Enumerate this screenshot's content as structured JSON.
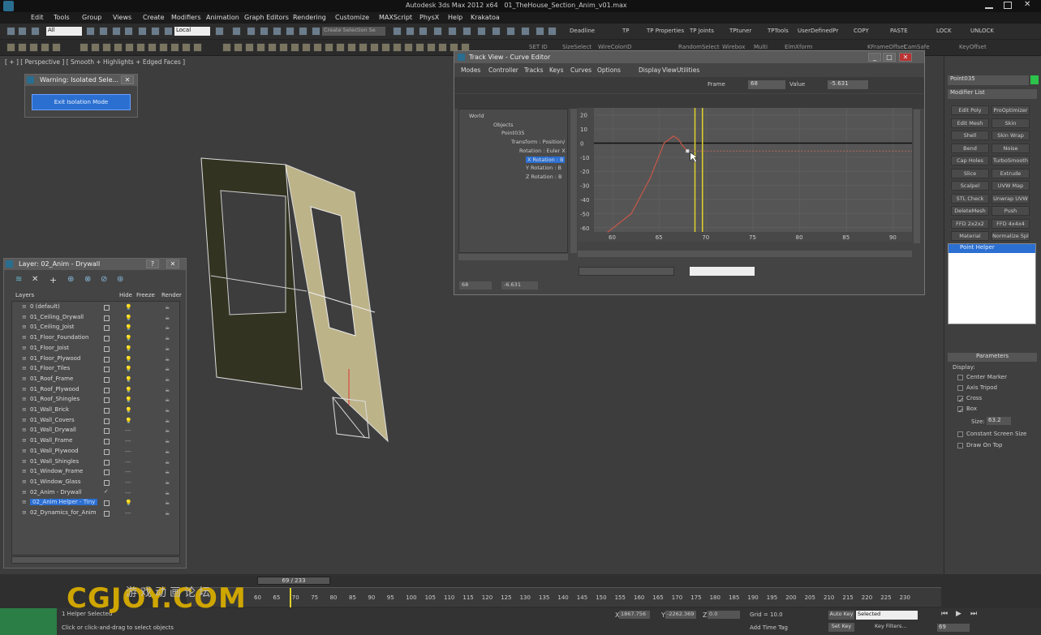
{
  "app": {
    "title": "Autodesk 3ds Max  2012 x64",
    "file": "01_TheHouse_Section_Anim_v01.max"
  },
  "menus": [
    "Edit",
    "Tools",
    "Group",
    "Views",
    "Create",
    "Modifiers",
    "Animation",
    "Graph Editors",
    "Rendering",
    "Customize",
    "MAXScript",
    "PhysX",
    "Help",
    "Krakatoa"
  ],
  "toolbar": {
    "filter": "All",
    "coord": "Local",
    "selset": "Create Selection Se",
    "labels": [
      "Deadline",
      "TP",
      "TP Properties",
      "TP Joints",
      "TPtuner",
      "TPTools",
      "UserDefinedPr",
      "COPY",
      "PASTE",
      "LOCK",
      "UNLOCK"
    ]
  },
  "toolbar2": {
    "labels": [
      "SET ID",
      "SizeSelect",
      "WireColorID",
      "RandomSelect",
      "Wirebox",
      "Multi",
      "ElmXform",
      "KFrameOffset",
      "CamSafe",
      "KeyOffset",
      "BG"
    ]
  },
  "viewport": {
    "label": "[ + ] [ Perspective ] [ Smooth + Highlights + Edged Faces ]"
  },
  "isolation": {
    "title": "Warning: Isolated Sele...",
    "button": "Exit Isolation Mode"
  },
  "layers": {
    "title": "Layer: 02_Anim - Drywall",
    "cols": {
      "name": "Layers",
      "hide": "Hide",
      "freeze": "Freeze",
      "render": "Render"
    },
    "items": [
      "0 (default)",
      "01_Ceiling_Drywall",
      "01_Ceiling_Joist",
      "01_Floor_Foundation",
      "01_Floor_Joist",
      "01_Floor_Plywood",
      "01_Floor_Tiles",
      "01_Roof_Frame",
      "01_Roof_Plywood",
      "01_Roof_Shingles",
      "01_Wall_Brick",
      "01_Wall_Covers",
      "01_Wall_Drywall",
      "01_Wall_Frame",
      "01_Wall_Plywood",
      "01_Wall_Shingles",
      "01_Window_Frame",
      "01_Window_Glass",
      "02_Anim - Drywall",
      "02_Anim Helper - Tiny",
      "02_Dynamics_for_Anim"
    ]
  },
  "trackview": {
    "title": "Track View - Curve Editor",
    "menus": [
      "Modes",
      "Controller",
      "Tracks",
      "Keys",
      "Curves",
      "Options",
      "Display",
      "View",
      "Utilities"
    ],
    "frame_label": "Frame",
    "frame": "68",
    "value_label": "Value",
    "value": "-5.631",
    "tree": [
      "World",
      "Objects",
      "Point035",
      "Transform : Position/",
      "Rotation : Euler X",
      "X Rotation : B",
      "Y Rotation : B",
      "Z Rotation : B"
    ],
    "bottom_frame": "68",
    "bottom_value": "-6.631"
  },
  "chart_data": {
    "type": "line",
    "title": "",
    "xlabel": "",
    "ylabel": "",
    "x_ticks": [
      60,
      65,
      70,
      75,
      80,
      85,
      90
    ],
    "y_ticks": [
      20,
      10,
      0,
      -10,
      -20,
      -30,
      -40,
      -50,
      -60
    ],
    "xlim": [
      58,
      92
    ],
    "ylim": [
      -63,
      25
    ],
    "series": [
      {
        "x": [
          59.5,
          62,
          64,
          65.5,
          66.5,
          67,
          67.5,
          68
        ],
        "y": [
          -63,
          -50,
          -25,
          0,
          5,
          3,
          -2,
          -5.6
        ]
      }
    ],
    "markers": [
      {
        "x": 68.8,
        "label": "current-frame"
      },
      {
        "x": 69.6,
        "label": "time-slider"
      }
    ]
  },
  "cmdpanel": {
    "objname": "Point035",
    "modlist": "Modifier List",
    "mods": [
      "Edit Poly",
      "ProOptimizer",
      "Edit Mesh",
      "Skin",
      "Shell",
      "Skin Wrap",
      "Bend",
      "Noise",
      "Cap Holes",
      "TurboSmooth",
      "Slice",
      "Extrude",
      "Scalpel",
      "UVW Map",
      "STL Check",
      "Unwrap UVW",
      "DeleteMesh",
      "Push",
      "FFD 2x2x2",
      "FFD 4x4x4",
      "Material",
      "Normalize Spl."
    ],
    "stack": "Point Helper",
    "params": "Parameters",
    "display": "Display:",
    "opts": [
      "Center Marker",
      "Axis Tripod",
      "Cross",
      "Box"
    ],
    "opts_checked": [
      false,
      false,
      true,
      true
    ],
    "size_label": "Size:",
    "size": "63.2",
    "more": [
      "Constant Screen Size",
      "Draw On Top"
    ]
  },
  "timeline": {
    "slider": "69 / 233",
    "ticks": [
      "60",
      "65",
      "70",
      "75",
      "80",
      "85",
      "90",
      "95",
      "100",
      "105",
      "110",
      "115",
      "120",
      "125",
      "130",
      "135",
      "140",
      "145",
      "150",
      "155",
      "160",
      "165",
      "170",
      "175",
      "180",
      "185",
      "190",
      "195",
      "200",
      "205",
      "210",
      "215",
      "220",
      "225",
      "230"
    ]
  },
  "status": {
    "selected": "1 Helper Selected",
    "hint": "Click or click-and-drag to select objects",
    "x": "1867.756",
    "y": "-2262.369",
    "z": "0.0",
    "grid": "Grid = 10.0",
    "autokey": "Auto Key",
    "setkey": "Set Key",
    "selmode": "Selected",
    "keyfilters": "Key Filters...",
    "frame": "69",
    "addtime": "Add Time Tag",
    "watermark": "CGJOY.COM",
    "watermark_cn": "游戏动画论坛"
  }
}
